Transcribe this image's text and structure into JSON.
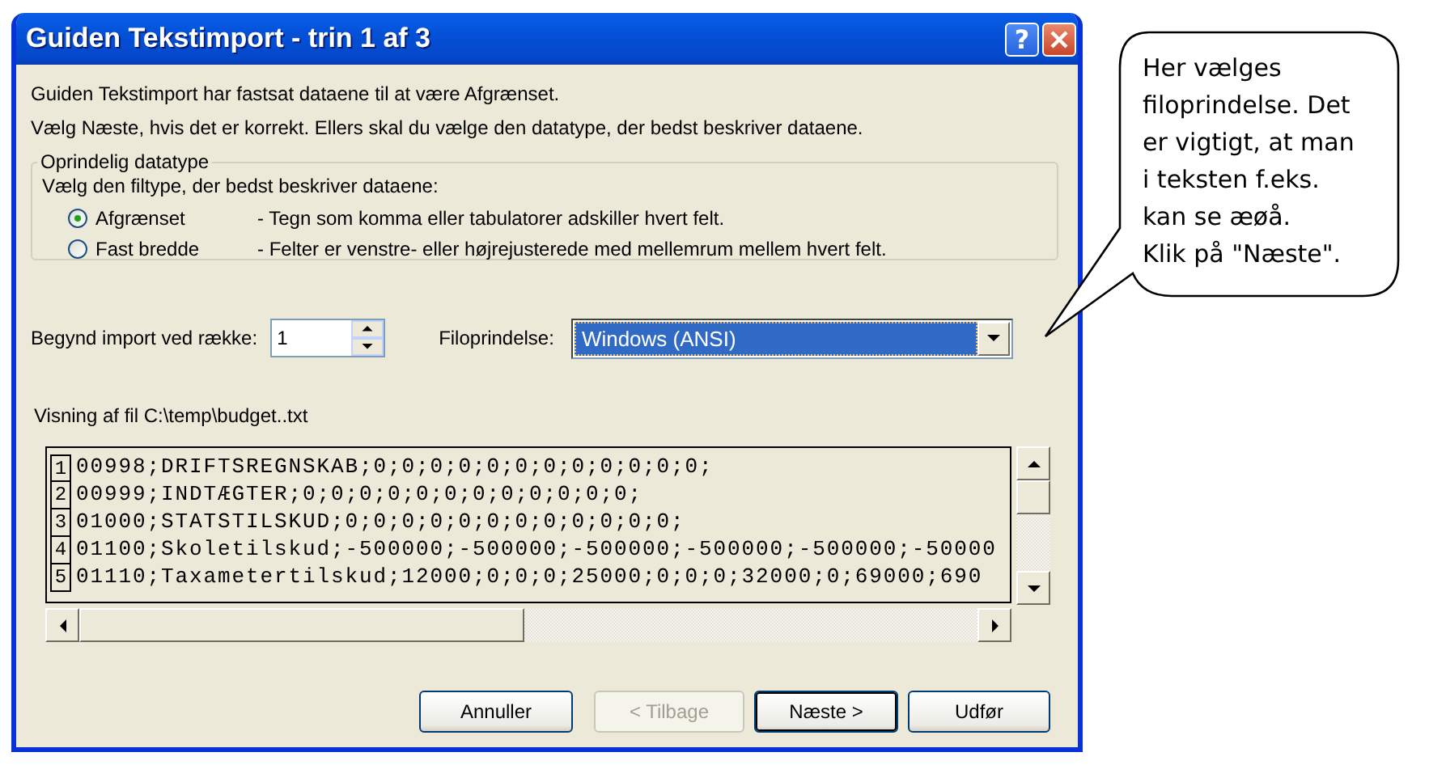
{
  "window": {
    "title": "Guiden Tekstimport - trin 1 af 3",
    "help_button": "?"
  },
  "intro": [
    "Guiden Tekstimport har fastsat dataene til at være Afgrænset.",
    "Vælg Næste, hvis det er korrekt. Ellers skal du vælge den datatype, der bedst beskriver dataene."
  ],
  "group": {
    "legend": "Oprindelig datatype",
    "prompt": "Vælg den filtype, der bedst beskriver dataene:",
    "options": [
      {
        "label": "Afgrænset",
        "description": "- Tegn som komma eller tabulatorer adskiller hvert felt.",
        "selected": true
      },
      {
        "label": "Fast bredde",
        "description": "- Felter er venstre- eller højrejusterede med mellemrum mellem hvert felt.",
        "selected": false
      }
    ]
  },
  "start_row": {
    "label": "Begynd import ved række:",
    "value": "1"
  },
  "file_origin": {
    "label": "Filoprindelse:",
    "value": "Windows (ANSI)"
  },
  "preview": {
    "label": "Visning af fil C:\\temp\\budget..txt",
    "rows": [
      {
        "number": "1",
        "text": "00998;DRIFTSREGNSKAB;0;0;0;0;0;0;0;0;0;0;0;0;"
      },
      {
        "number": "2",
        "text": "00999;INDTÆGTER;0;0;0;0;0;0;0;0;0;0;0;0;"
      },
      {
        "number": "3",
        "text": "01000;STATSTILSKUD;0;0;0;0;0;0;0;0;0;0;0;0;"
      },
      {
        "number": "4",
        "text": "01100;Skoletilskud;-500000;-500000;-500000;-500000;-500000;-50000"
      },
      {
        "number": "5",
        "text": "01110;Taxametertilskud;12000;0;0;0;25000;0;0;0;32000;0;69000;690"
      }
    ]
  },
  "buttons": [
    {
      "label": "Annuller",
      "disabled": false,
      "default": false
    },
    {
      "label": "< Tilbage",
      "disabled": true,
      "default": false
    },
    {
      "label": "Næste >",
      "disabled": false,
      "default": true
    },
    {
      "label": "Udfør",
      "disabled": false,
      "default": false
    }
  ],
  "callout": {
    "text": "Her vælges\nfiloprindelse. Det\ner vigtigt, at man\ni teksten f.eks.\nkan se æøå.\nKlik på \"Næste\"."
  }
}
